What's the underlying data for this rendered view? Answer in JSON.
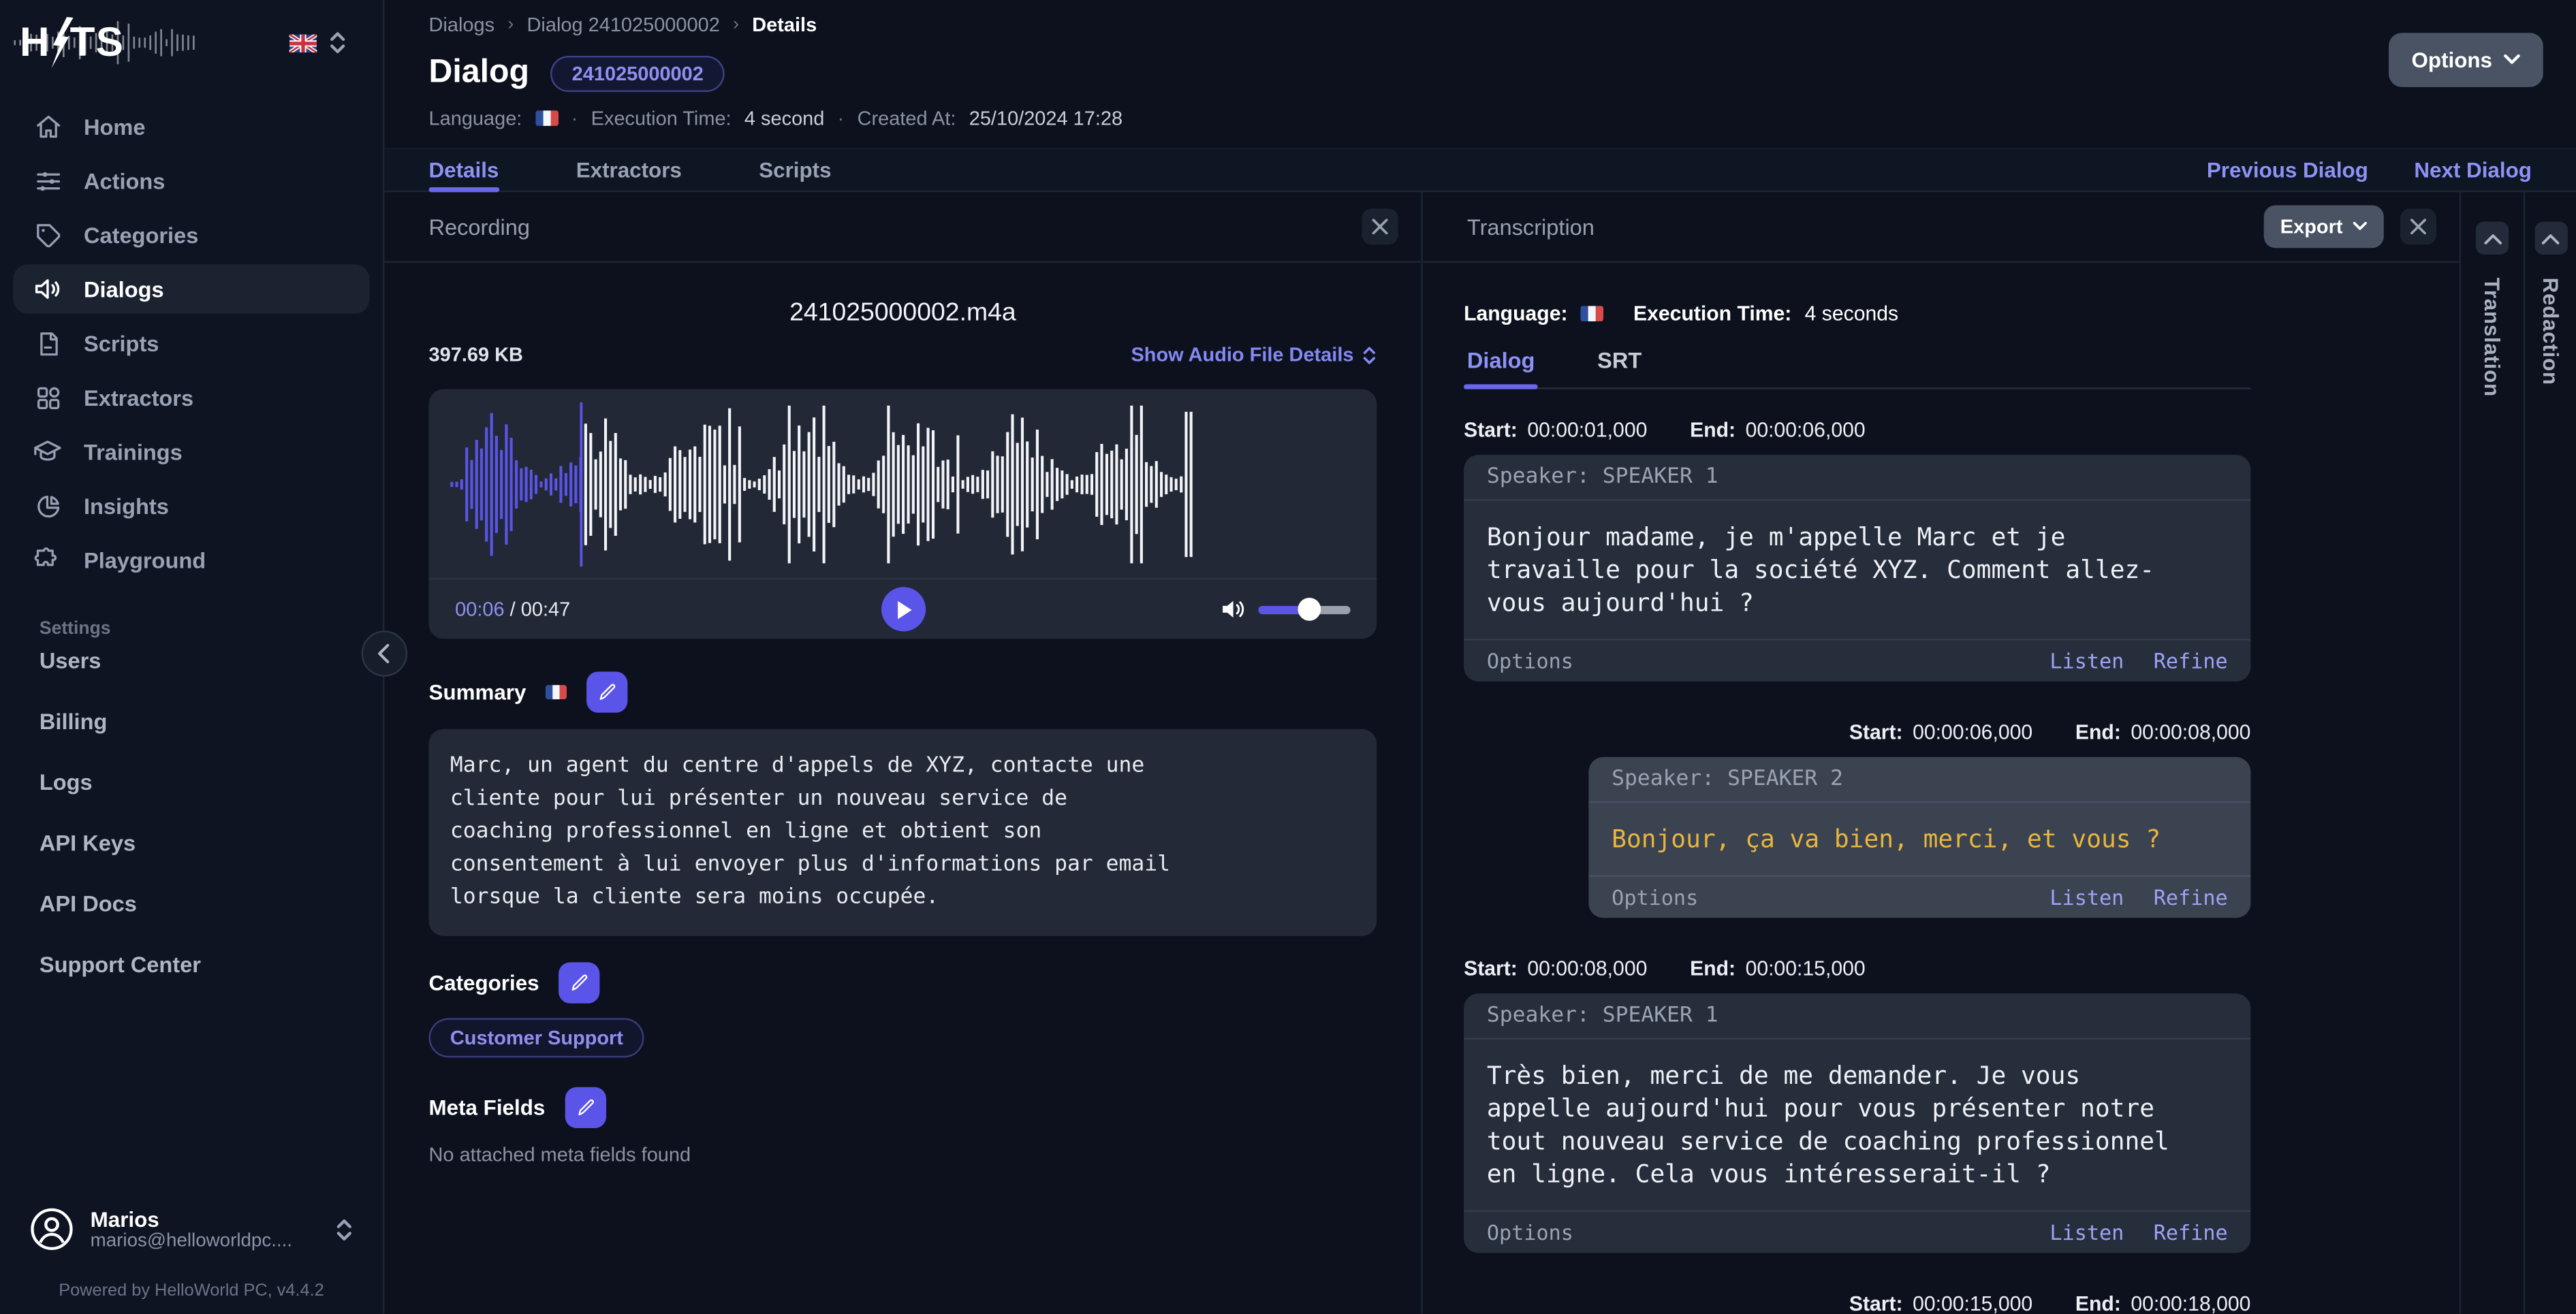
{
  "brand": {
    "logo_left": "H",
    "logo_right": "TS"
  },
  "sidebar": {
    "items": [
      {
        "label": "Home",
        "icon": "home-icon"
      },
      {
        "label": "Actions",
        "icon": "sliders-icon"
      },
      {
        "label": "Categories",
        "icon": "tag-icon"
      },
      {
        "label": "Dialogs",
        "icon": "speaker-icon",
        "active": true
      },
      {
        "label": "Scripts",
        "icon": "file-icon"
      },
      {
        "label": "Extractors",
        "icon": "grid-icon"
      },
      {
        "label": "Trainings",
        "icon": "graduation-cap-icon"
      },
      {
        "label": "Insights",
        "icon": "pie-chart-icon"
      },
      {
        "label": "Playground",
        "icon": "puzzle-icon"
      }
    ],
    "settings_label": "Settings",
    "settings_items": [
      "Users",
      "Billing",
      "Logs",
      "API Keys",
      "API Docs",
      "Support Center"
    ],
    "user": {
      "name": "Marios",
      "email": "marios@helloworldpc...."
    },
    "footer": "Powered by HelloWorld PC, v4.4.2"
  },
  "breadcrumb": [
    "Dialogs",
    "Dialog 241025000002",
    "Details"
  ],
  "header": {
    "title": "Dialog",
    "badge": "241025000002",
    "language_label": "Language:",
    "execution_label": "Execution Time:",
    "execution_value": "4 second",
    "created_label": "Created At:",
    "created_value": "25/10/2024 17:28",
    "options_label": "Options"
  },
  "tabs": {
    "items": [
      "Details",
      "Extractors",
      "Scripts"
    ],
    "active": "Details",
    "prev_label": "Previous Dialog",
    "next_label": "Next Dialog"
  },
  "recording": {
    "panel_title": "Recording",
    "file_name": "241025000002.m4a",
    "file_size": "397.69 KB",
    "details_link": "Show Audio File Details",
    "player": {
      "current_time": "00:06",
      "separator": "/",
      "duration": "00:47",
      "played_fraction": 0.175,
      "volume_fraction": 0.55,
      "played_color": "#5b54e8",
      "remaining_color": "#f2f4f8",
      "cursor_color": "#5b54e8"
    },
    "summary": {
      "label": "Summary",
      "text": "Marc, un agent du centre d'appels de XYZ, contacte une\ncliente pour lui présenter un nouveau service de\ncoaching professionnel en ligne et obtient son\nconsentement à lui envoyer plus d'informations par email\nlorsque la cliente sera moins occupée."
    },
    "categories": {
      "label": "Categories",
      "badges": [
        "Customer Support"
      ]
    },
    "meta_fields": {
      "label": "Meta Fields",
      "empty_text": "No attached meta fields found"
    }
  },
  "transcription": {
    "panel_title": "Transcription",
    "export_label": "Export",
    "language_label": "Language:",
    "execution_label": "Execution Time:",
    "execution_value": "4 seconds",
    "tabs": [
      "Dialog",
      "SRT"
    ],
    "active_tab": "Dialog",
    "labels": {
      "start": "Start:",
      "end": "End:",
      "options": "Options",
      "listen": "Listen",
      "refine": "Refine"
    },
    "segments": [
      {
        "start": "00:00:01,000",
        "end": "00:00:06,000",
        "speaker": "Speaker: SPEAKER 1",
        "text": "Bonjour madame, je m'appelle Marc et je\ntravaille pour la société XYZ. Comment allez-\nvous aujourd'hui ?",
        "align": "left",
        "highlight": false
      },
      {
        "start": "00:00:06,000",
        "end": "00:00:08,000",
        "speaker": "Speaker: SPEAKER 2",
        "text": "Bonjour, ça va bien, merci, et vous ?",
        "align": "right",
        "highlight": true
      },
      {
        "start": "00:00:08,000",
        "end": "00:00:15,000",
        "speaker": "Speaker: SPEAKER 1",
        "text": "Très bien, merci de me demander. Je vous\nappelle aujourd'hui pour vous présenter notre\ntout nouveau service de coaching professionnel\nen ligne. Cela vous intéresserait-il ?",
        "align": "left",
        "highlight": false
      },
      {
        "start": "00:00:15,000",
        "end": "00:00:18,000",
        "align": "right",
        "partial": true
      }
    ]
  },
  "side_tabs": [
    {
      "label": "Translation"
    },
    {
      "label": "Redaction"
    }
  ],
  "colors": {
    "accent": "#5b54e8",
    "link": "#8489f2",
    "highlight_text": "#e9b63e",
    "badge_text": "#918ef2"
  }
}
